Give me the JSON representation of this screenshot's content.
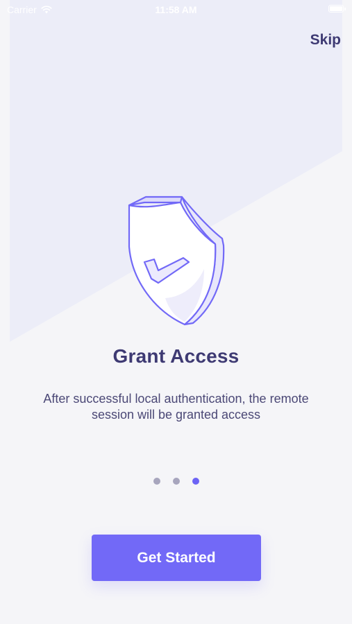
{
  "status_bar": {
    "carrier": "Carrier",
    "time": "11:58 AM",
    "battery_level": 1.0
  },
  "colors": {
    "background": "#f5f5f8",
    "background_shape": "#ecedf8",
    "accent": "#7269f7",
    "title_text": "#3e3a73",
    "dot_inactive": "#a7a5bd",
    "dot_active": "#6c63f5"
  },
  "header": {
    "skip_label": "Skip"
  },
  "illustration": {
    "icon": "shield-check-icon"
  },
  "onboarding": {
    "title": "Grant Access",
    "description": "After successful local authentication, the remote session will be granted access",
    "page_count": 3,
    "current_page": 3
  },
  "cta": {
    "label": "Get Started"
  }
}
